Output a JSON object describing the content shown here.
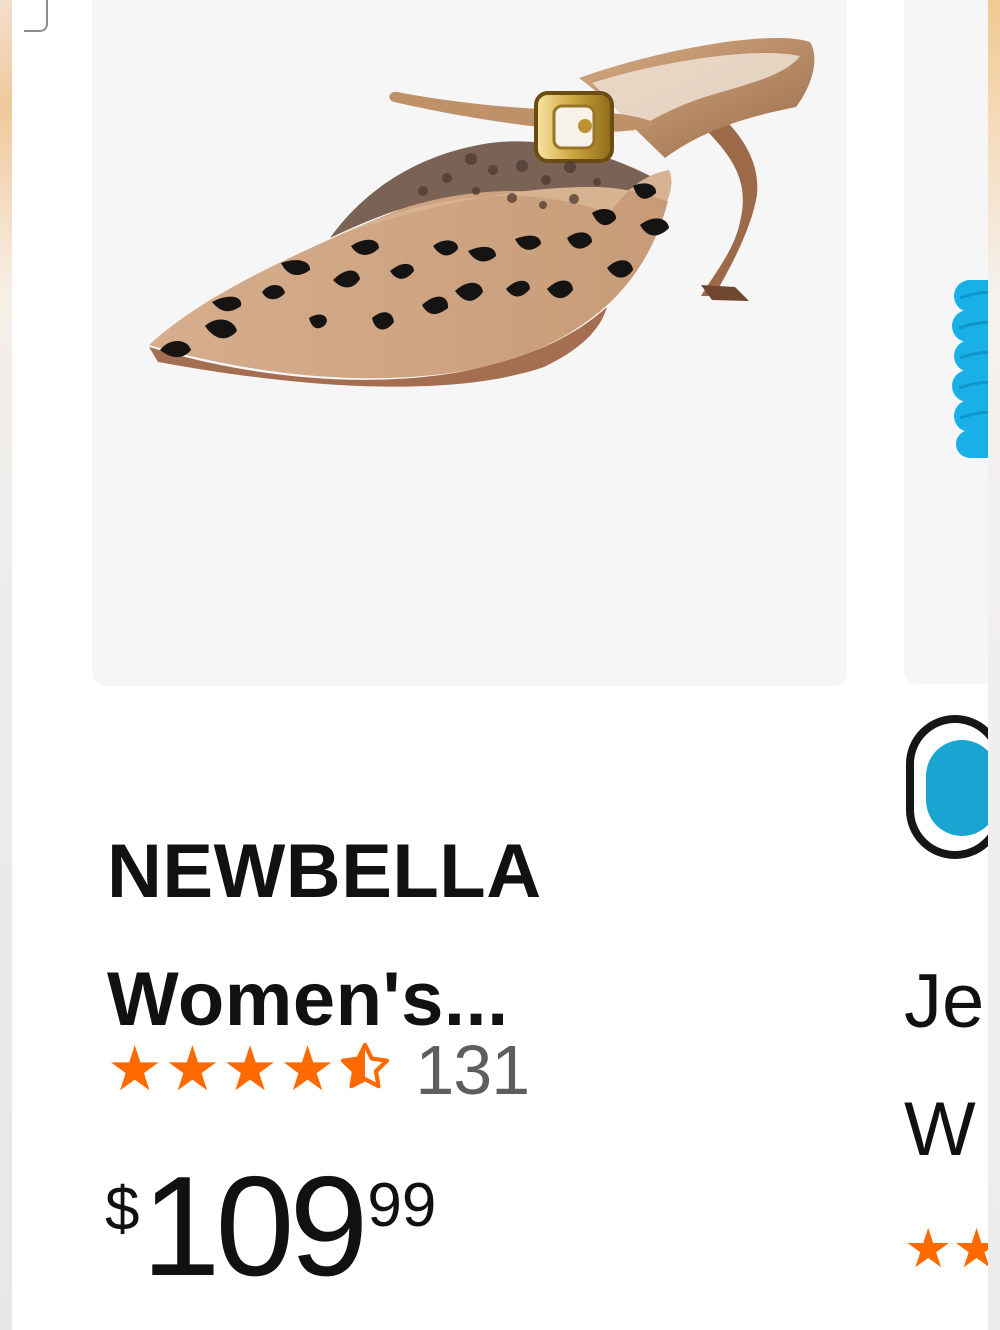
{
  "product": {
    "title_line1": "NEWBELLA",
    "title_line2": "Women's...",
    "rating_stars": 4.5,
    "review_count": "131",
    "price": {
      "symbol": "$",
      "whole": "109",
      "fraction": "99"
    },
    "image_icon": "pointed-toe-mule-heel-image"
  },
  "next_product": {
    "title_partial_line1": "Je",
    "title_partial_line2": "W",
    "partial_stars": "★★",
    "swatch_color": "#1aa4d1",
    "image_icon": "blue-product-image"
  },
  "colors": {
    "star_orange": "#ff6a00",
    "tile_background": "#f6f6f6",
    "text": "#111111",
    "review_count": "#5e5e5e",
    "accent_blue": "#1aa4d1"
  }
}
